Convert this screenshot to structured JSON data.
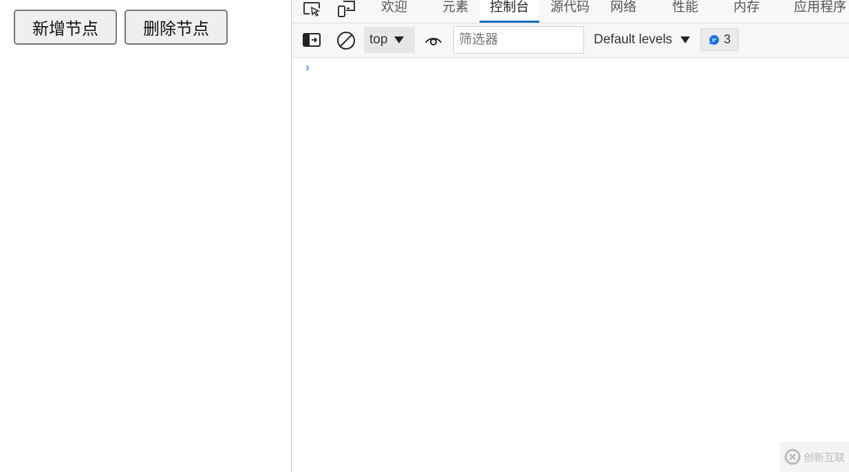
{
  "page": {
    "add_button": "新增节点",
    "delete_button": "删除节点"
  },
  "devtools": {
    "tabs": [
      {
        "label": "欢迎"
      },
      {
        "label": "元素"
      },
      {
        "label": "控制台",
        "active": true
      },
      {
        "label": "源代码"
      },
      {
        "label": "网络"
      },
      {
        "label": "性能"
      },
      {
        "label": "内存"
      },
      {
        "label": "应用程序"
      }
    ],
    "toolbar": {
      "context": "top",
      "filter_placeholder": "筛选器",
      "levels": "Default levels",
      "message_count": "3"
    },
    "prompt": "›",
    "accent": "#0f6cbd"
  },
  "watermark": {
    "text": "创新互联"
  }
}
